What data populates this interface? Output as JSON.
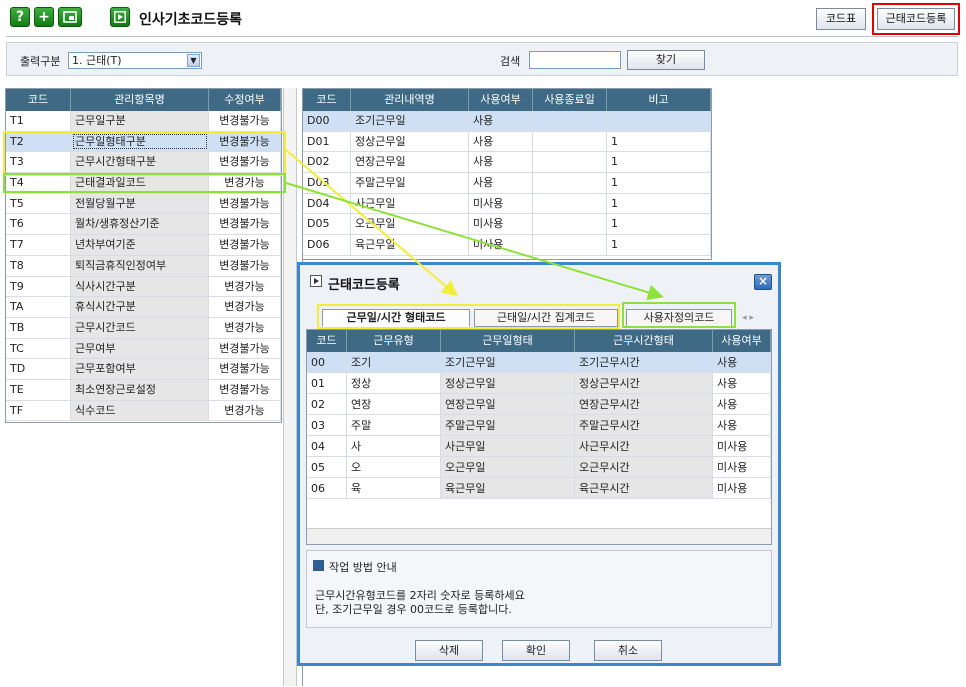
{
  "page": {
    "title": "인사기초코드등록"
  },
  "toolbar": {
    "icons": [
      "help-icon",
      "add-icon",
      "window-icon",
      "play-icon"
    ],
    "help_glyph": "?",
    "add_glyph": "+",
    "code_table_label": "코드표",
    "attendance_code_label": "근태코드등록"
  },
  "filter": {
    "output_label": "출력구분",
    "output_value": "1. 근태(T)",
    "search_label": "검색",
    "search_value": "",
    "find_label": "찾기"
  },
  "left_grid": {
    "headers": [
      "코드",
      "관리항목명",
      "수정여부"
    ],
    "rows": [
      [
        "T1",
        "근무일구분",
        "변경불가능"
      ],
      [
        "T2",
        "근무일형태구분",
        "변경불가능"
      ],
      [
        "T3",
        "근무시간형태구분",
        "변경불가능"
      ],
      [
        "T4",
        "근태결과일코드",
        "변경가능"
      ],
      [
        "T5",
        "전월당월구분",
        "변경불가능"
      ],
      [
        "T6",
        "월차/생휴정산기준",
        "변경불가능"
      ],
      [
        "T7",
        "년차부여기준",
        "변경불가능"
      ],
      [
        "T8",
        "퇴직금휴직인정여부",
        "변경불가능"
      ],
      [
        "T9",
        "식사시간구분",
        "변경가능"
      ],
      [
        "TA",
        "휴식시간구분",
        "변경가능"
      ],
      [
        "TB",
        "근무시간코드",
        "변경가능"
      ],
      [
        "TC",
        "근무여부",
        "변경불가능"
      ],
      [
        "TD",
        "근무포함여부",
        "변경불가능"
      ],
      [
        "TE",
        "최소연장근로설정",
        "변경불가능"
      ],
      [
        "TF",
        "식수코드",
        "변경가능"
      ]
    ]
  },
  "right_grid": {
    "headers": [
      "코드",
      "관리내역명",
      "사용여부",
      "사용종료일",
      "비고"
    ],
    "rows": [
      [
        "D00",
        "조기근무일",
        "사용",
        "",
        ""
      ],
      [
        "D01",
        "정상근무일",
        "사용",
        "",
        "1"
      ],
      [
        "D02",
        "연장근무일",
        "사용",
        "",
        "1"
      ],
      [
        "D03",
        "주말근무일",
        "사용",
        "",
        "1"
      ],
      [
        "D04",
        "사근무일",
        "미사용",
        "",
        "1"
      ],
      [
        "D05",
        "오근무일",
        "미사용",
        "",
        "1"
      ],
      [
        "D06",
        "육근무일",
        "미사용",
        "",
        "1"
      ]
    ]
  },
  "dialog": {
    "title": "근태코드등록",
    "close_glyph": "×",
    "tabs": [
      "근무일/시간 형태코드",
      "근태일/시간 집계코드",
      "사용자정의코드"
    ],
    "tab_arrows": "◂ ▸",
    "headers": [
      "코드",
      "근무유형",
      "근무일형태",
      "근무시간형태",
      "사용여부"
    ],
    "rows": [
      [
        "00",
        "조기",
        "조기근무일",
        "조기근무시간",
        "사용"
      ],
      [
        "01",
        "정상",
        "정상근무일",
        "정상근무시간",
        "사용"
      ],
      [
        "02",
        "연장",
        "연장근무일",
        "연장근무시간",
        "사용"
      ],
      [
        "03",
        "주말",
        "주말근무일",
        "주말근무시간",
        "사용"
      ],
      [
        "04",
        "사",
        "사근무일",
        "사근무시간",
        "미사용"
      ],
      [
        "05",
        "오",
        "오근무일",
        "오근무시간",
        "미사용"
      ],
      [
        "06",
        "육",
        "육근무일",
        "육근무시간",
        "미사용"
      ]
    ],
    "info_title": "작업 방법 안내",
    "info_line1": "근무시간유형코드를 2자리 숫자로 등록하세요",
    "info_line2": "단, 조기근무일 경우 00코드로 등록합니다.",
    "buttons": {
      "delete": "삭제",
      "confirm": "확인",
      "cancel": "취소"
    }
  },
  "colors": {
    "header_bg": "#3f6a86",
    "dialog_border": "#3a86d0",
    "highlight_yellow": "#f4ec3a",
    "highlight_green": "#8ee03a",
    "highlight_red": "#e00000"
  }
}
